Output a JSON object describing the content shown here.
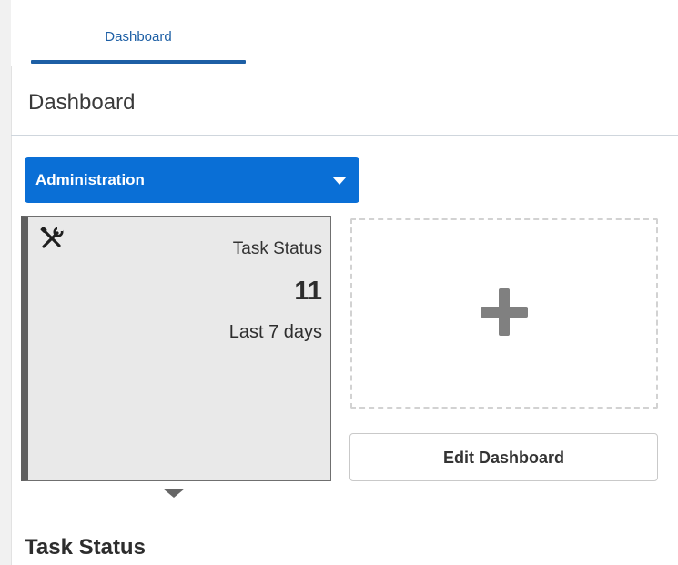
{
  "tabs": [
    {
      "label": "Dashboard",
      "active": true
    }
  ],
  "page": {
    "title": "Dashboard"
  },
  "dashboard_selector": {
    "selected": "Administration",
    "icon": "chevron-down-icon"
  },
  "tiles": [
    {
      "icon": "tools-icon",
      "title": "Task Status",
      "count": "11",
      "period": "Last 7 days"
    }
  ],
  "add_tile": {
    "icon": "plus-icon"
  },
  "edit_button": {
    "label": "Edit Dashboard"
  },
  "section": {
    "heading": "Task Status"
  },
  "colors": {
    "accent": "#1d5fa5",
    "dropdown_bg": "#0a6fd6",
    "tile_bg": "#e9e9e9",
    "tile_border": "#5f5f5f",
    "plus": "#808080"
  }
}
